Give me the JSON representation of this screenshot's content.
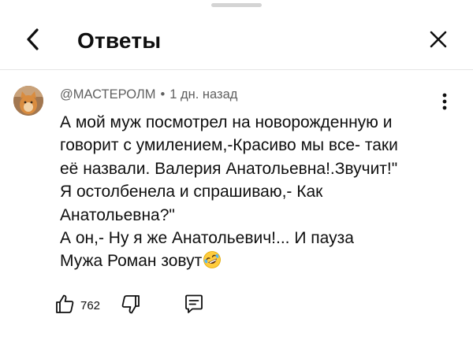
{
  "header": {
    "title": "Ответы",
    "back_icon": "chevron-left-icon",
    "close_icon": "close-icon"
  },
  "comment": {
    "author": "@МАСТЕРОЛМ",
    "separator": "•",
    "time": "1 дн. назад",
    "lines": [
      "А мой муж посмотрел на новорожденную и",
      "говорит с умилением,-Красиво мы все- таки",
      "её назвали. Валерия Анатольевна!.Звучит!\"",
      "Я остолбенела и спрашиваю,- Как",
      "Анатольевна?\"",
      "А он,- Ну я же Анатольевич!... И пауза",
      "Мужа Роман зовут"
    ],
    "emoji": "rolling-on-floor-laughing-emoji",
    "likes": "762"
  },
  "icons": {
    "like": "thumbs-up-icon",
    "dislike": "thumbs-down-icon",
    "reply": "comment-icon",
    "more": "more-vertical-icon"
  }
}
